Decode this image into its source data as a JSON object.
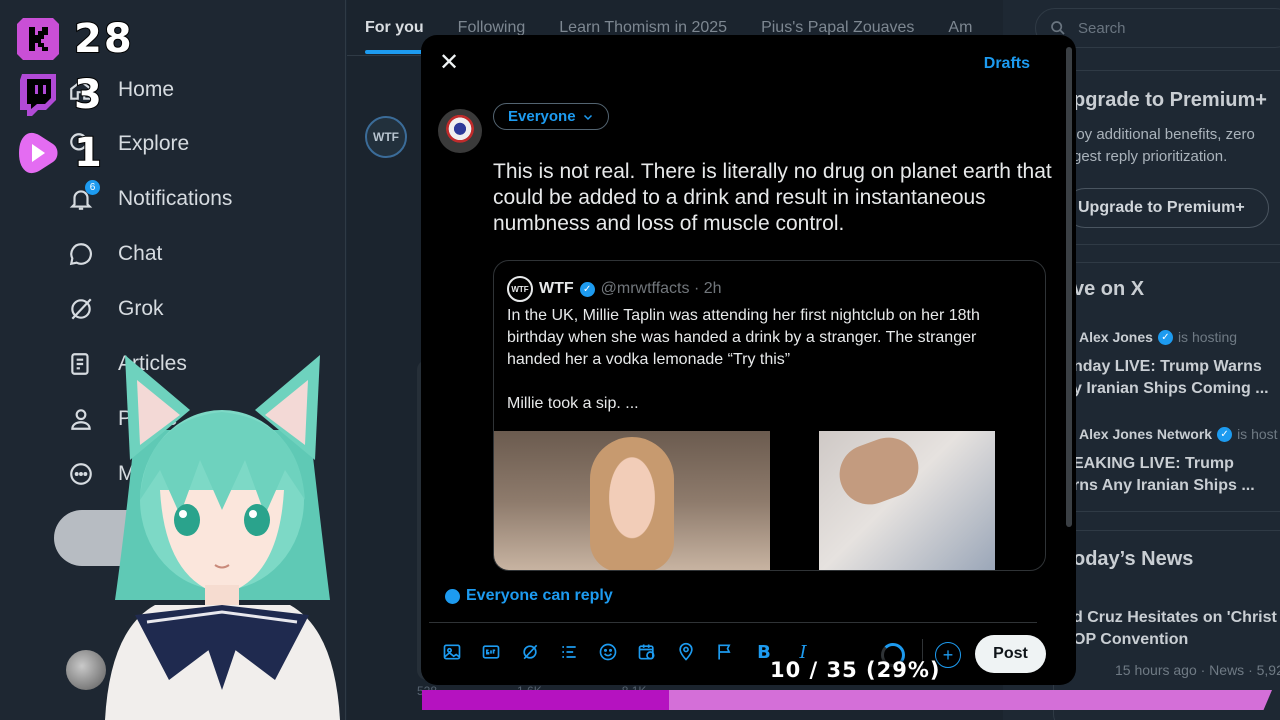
{
  "nav": {
    "items": [
      {
        "label": "Home",
        "icon": "home-icon"
      },
      {
        "label": "Explore",
        "icon": "search-icon"
      },
      {
        "label": "Notifications",
        "icon": "bell-icon",
        "badge": "6"
      },
      {
        "label": "Chat",
        "icon": "chat-icon"
      },
      {
        "label": "Grok",
        "icon": "grok-icon"
      },
      {
        "label": "Articles",
        "icon": "articles-icon"
      },
      {
        "label": "Profile",
        "icon": "person-icon"
      },
      {
        "label": "More",
        "icon": "more-icon"
      }
    ]
  },
  "timeline": {
    "tabs": [
      "For you",
      "Following",
      "Learn Thomism in 2025",
      "Pius's Papal Zouaves",
      "Am"
    ],
    "avatar_text": "WTF",
    "stats": [
      "528",
      "1.6K",
      "8.1K"
    ]
  },
  "right": {
    "search_placeholder": "Search",
    "premium_title": "pgrade to Premium+",
    "premium_text_1": "joy additional benefits, zero",
    "premium_text_2": "gest reply prioritization.",
    "premium_button": "Upgrade to Premium+",
    "live_title": "ve on X",
    "live": [
      {
        "host": "Alex Jones",
        "action": "is hosting",
        "line1": "nday LIVE: Trump Warns",
        "line2": "y Iranian Ships Coming ..."
      },
      {
        "host": "Alex Jones Network",
        "action": "is host",
        "line1": "EAKING LIVE: Trump",
        "line2": "rns Any Iranian Ships ..."
      }
    ],
    "news_title": "oday’s News",
    "news": {
      "line1": "d Cruz Hesitates on 'Christ",
      "line2": "OP Convention",
      "meta": "15 hours ago · News · 5,92"
    }
  },
  "modal": {
    "drafts_label": "Drafts",
    "audience_label": "Everyone",
    "compose_text": "This is not real. There is literally no drug on planet earth that could be added to a drink and result in instantaneous numbness and loss of muscle control.",
    "quote": {
      "logo_text": "WTF",
      "name": "WTF",
      "handle": "@mrwtffacts · 2h",
      "body": "In the UK, Millie Taplin was attending her first nightclub on her 18th birthday when she was handed a drink by a stranger. The stranger handed her a vodka lemonade “Try this”\n\nMillie took a sip. ..."
    },
    "reply_setting": "Everyone can reply",
    "post_label": "Post"
  },
  "overlay": {
    "stats": [
      {
        "icon": "kick-icon",
        "value": "28",
        "color": "#c94fd6"
      },
      {
        "icon": "twitch-icon",
        "value": "3",
        "color": "#b14ad6"
      },
      {
        "icon": "rumble-icon",
        "value": "1",
        "color": "#e46cf2"
      }
    ],
    "counter": "10 / 35 (29%)",
    "progress_fraction": 0.29,
    "colors": {
      "fill": "#b512c0",
      "track": "#d46fd8"
    }
  }
}
